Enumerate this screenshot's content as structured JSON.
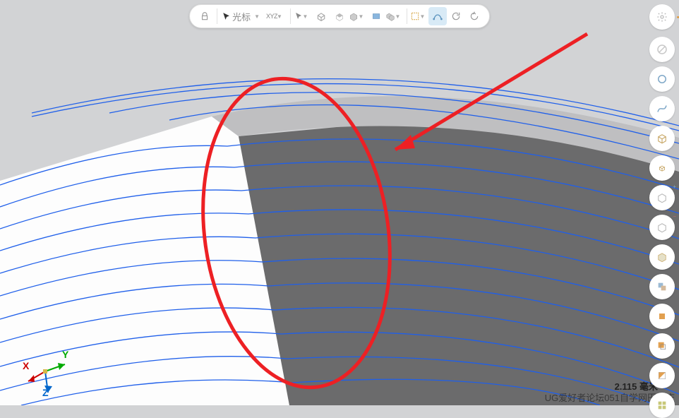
{
  "toolbar": {
    "cursor_label": "光标",
    "axes_label": "XYZ"
  },
  "triad": {
    "x": "X",
    "y": "Y",
    "z": "Z"
  },
  "scale": {
    "value": "2.115 毫米"
  },
  "watermark": "UG爱好者论坛051自学网田开庆",
  "colors": {
    "annotation": "#ed2024",
    "curves": "#1f5fea",
    "dark_face": "#6b6b6c",
    "white_face": "#fdfdfd",
    "bg": "#d2d3d5"
  }
}
